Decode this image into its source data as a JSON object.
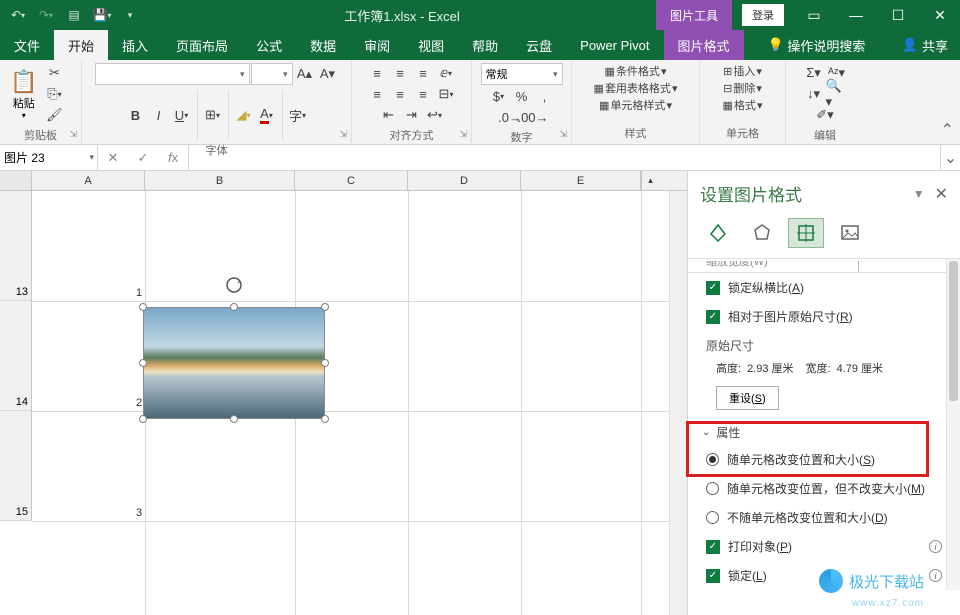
{
  "titlebar": {
    "title": "工作簿1.xlsx  -  Excel",
    "context_tool": "图片工具",
    "login": "登录"
  },
  "tabs": {
    "file": "文件",
    "home": "开始",
    "insert": "插入",
    "layout": "页面布局",
    "formula": "公式",
    "data": "数据",
    "review": "审阅",
    "view": "视图",
    "help": "帮助",
    "cloud": "云盘",
    "powerpivot": "Power Pivot",
    "picformat": "图片格式",
    "tellme": "操作说明搜索",
    "share": "共享"
  },
  "ribbon": {
    "clipboard": {
      "paste": "粘贴",
      "label": "剪贴板"
    },
    "font": {
      "label": "字体"
    },
    "align": {
      "label": "对齐方式"
    },
    "number": {
      "label": "数字",
      "format": "常规"
    },
    "styles": {
      "label": "样式",
      "cond": "条件格式",
      "table": "套用表格格式",
      "cell": "单元格样式"
    },
    "cells": {
      "label": "单元格",
      "insert": "插入",
      "delete": "删除",
      "format": "格式"
    },
    "editing": {
      "label": "编辑"
    }
  },
  "namebox": "图片 23",
  "rows": {
    "r13_num": "1",
    "r14_num": "2",
    "r15_num": "3",
    "r13": "13",
    "r14": "14",
    "r15": "15"
  },
  "taskpane": {
    "title": "设置图片格式",
    "scale_cut": "缩放宽度(W)",
    "lock_aspect": "锁定纵横比(A)",
    "rel_orig": "相对于图片原始尺寸(R)",
    "orig_size": "原始尺寸",
    "height_lbl": "高度:",
    "height_val": "2.93 厘米",
    "width_lbl": "宽度:",
    "width_val": "4.79 厘米",
    "reset": "重设(S)",
    "props": "属性",
    "opt1": "随单元格改变位置和大小(S)",
    "opt2": "随单元格改变位置，但不改变大小(M)",
    "opt3": "不随单元格改变位置和大小(D)",
    "print": "打印对象(P)",
    "locked": "锁定(L)"
  },
  "watermark": {
    "text": "极光下载站",
    "sub": "www.xz7.com"
  }
}
